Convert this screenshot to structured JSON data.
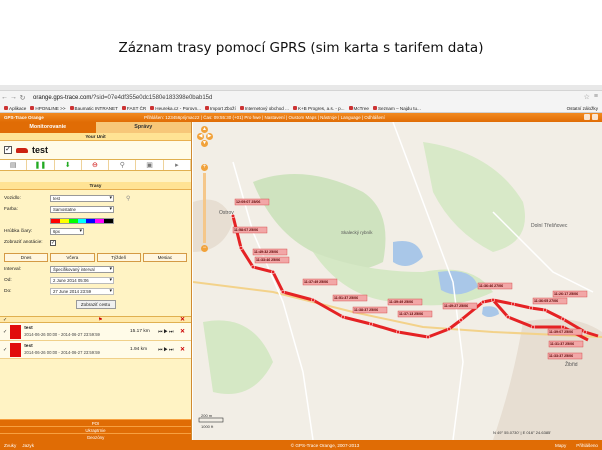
{
  "caption": "Záznam trasy pomocí GPRS (sim karta s tarifem data)",
  "browser": {
    "url_prefix": "orange.gps-trace.com",
    "url_rest": "/?sid=07e4df355e0dc1580e183398e0bab15d",
    "bookmarks": [
      "Aplikace",
      "HPONLINE >>",
      "Baumatic INTRANET",
      "FAST ČR",
      "Heureka.cz - Porovn...",
      "Import Zboží",
      "Internetový obchod ...",
      "K+B Progres, a.s. - p...",
      "McTree",
      "Seznam – Najdu tu..."
    ],
    "other_bookmarks": "Ostatní záložky"
  },
  "app": {
    "brand": "GPS-Trace Orange",
    "header_info": "Přihlášen: 123456prijmacz2 | Čas: 09:55:30 (+01) Pro hwe | Nastavení | Oustom Maps | Nástroje | Language | Odhlášení"
  },
  "panel": {
    "tabs": [
      "Monitorovanie",
      "Správy"
    ],
    "your_unit": "Your Unit",
    "unit_name": "test",
    "trasy_header": "Trasy",
    "form": {
      "vozidlo_label": "Vozidlo:",
      "vozidlo_value": "test",
      "farba_label": "Farba:",
      "farba_value": "Samostatne",
      "hrubka_label": "Hrúbka čiary:",
      "hrubka_value": "6px",
      "anot_label": "Zobraziť anotácie:",
      "interval_label": "Interval:",
      "interval_value": "Špecifikovaný interval",
      "od_label": "Od:",
      "od_value": "2 June 2014 05:06",
      "do_label": "Do:",
      "do_value": "27 June 2014 23:59"
    },
    "ranges": [
      "Dnes",
      "Včera",
      "Týždeň",
      "Mesiac"
    ],
    "show_button": "Zobraziť cestu",
    "trips": [
      {
        "name": "test",
        "period": "2014-06-26 00:00 - 2014-06-27 23:59:59",
        "distance": "15.17 km"
      },
      {
        "name": "test",
        "period": "2014-06-26 00:00 - 2014-06-27 23:59:59",
        "distance": "1.94 km"
      }
    ],
    "bottom_links": [
      "POI",
      "Ukraptrnie",
      "Geozóny"
    ],
    "swatch_colors": [
      "#ff0000",
      "#ffff00",
      "#00ff00",
      "#00ffff",
      "#0000ff",
      "#ff00ff",
      "#000000"
    ]
  },
  "map": {
    "places": [
      "Ostrov",
      "Dolní Třešňovec",
      "Skalecký rybník",
      "Žibřid"
    ],
    "scale_labels": [
      "200 m",
      "1000 ft"
    ],
    "coords": "N 49° 55.0730' | E 016° 24.6385'",
    "waypoints": [
      "12:09:07 25/06",
      "11:58:07 25/06",
      "11:49:32 25/06",
      "11:33:46 25/06",
      "11:37:49 25/06",
      "11:51:37 25/06",
      "11:38:37 25/06",
      "11:39:49 25/06",
      "11:37:13 25/06",
      "11:49:27 25/06",
      "11:36:46 27/06",
      "11:36:05 27/06",
      "11:26:17 25/06",
      "11:39:07 25/06",
      "11:31:37 25/06",
      "11:33:37 25/06"
    ]
  },
  "footer": {
    "copyright": "© GPS-Trace Orange, 2007-2013",
    "left": [
      "Zvuky",
      "Jazyk"
    ],
    "right": [
      "Mapy",
      "Přihlášeno"
    ]
  },
  "colors": {
    "accent": "#e06c05",
    "route": "#e52224",
    "panel_bg": "#fff3c4",
    "map_bg": "#f2eee6"
  }
}
